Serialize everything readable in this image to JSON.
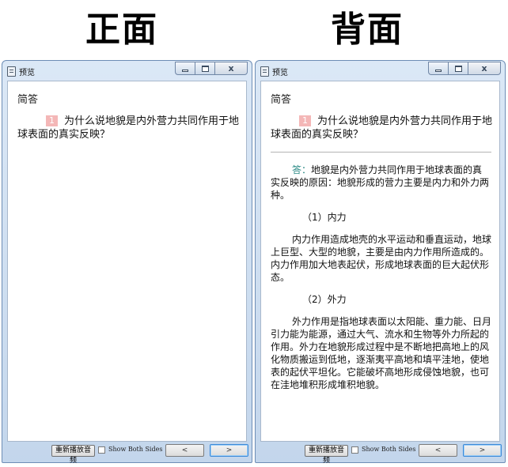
{
  "headings": {
    "front": "正面",
    "back": "背面"
  },
  "window": {
    "title": "预览",
    "controls": {
      "minimize": "─",
      "maximize": "□",
      "close": "x"
    }
  },
  "card": {
    "type_label": "简答",
    "question_number": "1",
    "question": "为什么说地貌是内外营力共同作用于地球表面的真实反映？",
    "answer_lead": "答：",
    "answer_intro": "地貌是内外营力共同作用于地球表面的真实反映的原因：地貌形成的营力主要是内力和外力两种。",
    "internal_heading": "（1）内力",
    "internal_text": "内力作用造成地壳的水平运动和垂直运动，地球上巨型、大型的地貌，主要是由内力作用所造成的。内力作用加大地表起伏，形成地球表面的巨大起伏形态。",
    "external_heading": "（2）外力",
    "external_text": "外力作用是指地球表面以太阳能、重力能、日月引力能为能源，通过大气、流水和生物等外力所起的作用。外力在地貌形成过程中是不断地把高地上的风化物质搬运到低地，逐渐夷平高地和填平洼地，使地表的起伏平坦化。它能破坏高地形成侵蚀地貌，也可在洼地堆积形成堆积地貌。"
  },
  "bottom": {
    "replay_audio": "重新播放音频",
    "show_both_sides": "Show Both Sides",
    "prev": "<",
    "next": ">"
  }
}
